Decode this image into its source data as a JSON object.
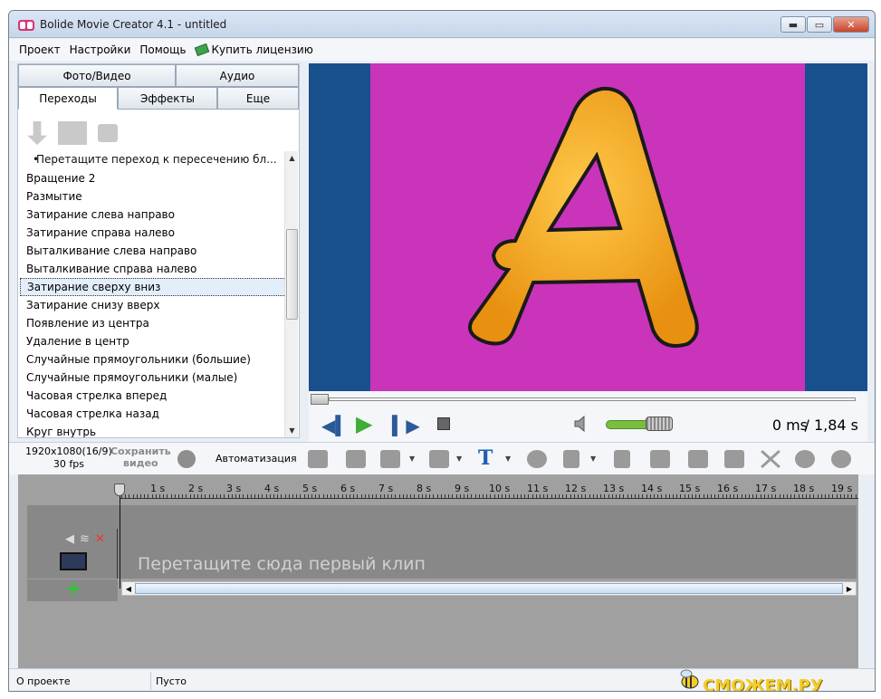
{
  "window": {
    "title": "Bolide Movie Creator 4.1 - untitled",
    "min": "▬",
    "max": "▭",
    "close": "✕"
  },
  "menu": {
    "items": [
      "Проект",
      "Настройки",
      "Помощь"
    ],
    "buy": "Купить лицензию"
  },
  "tabs": {
    "row1": [
      "Фото/Видео",
      "Аудио"
    ],
    "row2": [
      "Переходы",
      "Эффекты",
      "Еще"
    ]
  },
  "transitions": {
    "hint": "Перетащите переход к пересечению бл...",
    "items": [
      "Вращение 2",
      "Размытие",
      "Затирание слева направо",
      "Затирание справа налево",
      "Выталкивание слева направо",
      "Выталкивание справа налево",
      "Затирание сверху вниз",
      "Затирание снизу вверх",
      "Появление из центра",
      "Удаление в центр",
      "Случайные прямоугольники (большие)",
      "Случайные прямоугольники (малые)",
      "Часовая стрелка вперед",
      "Часовая стрелка назад",
      "Круг внутрь"
    ],
    "selected_index": 6
  },
  "playback": {
    "current": "0 ms",
    "total": "/ 1,84 s",
    "volume_fraction": 0.85
  },
  "toolbar": {
    "resolution": "1920x1080(16/9)",
    "fps": "30 fps",
    "save_video_line1": "Сохранить",
    "save_video_line2": "видео",
    "automation": "Автоматизация"
  },
  "timeline": {
    "ticks": [
      "1 s",
      "2 s",
      "3 s",
      "4 s",
      "5 s",
      "6 s",
      "7 s",
      "8 s",
      "9 s",
      "10 s",
      "11 s",
      "12 s",
      "13 s",
      "14 s",
      "15 s",
      "16 s",
      "17 s",
      "18 s",
      "19 s"
    ],
    "drop_hint": "Перетащите сюда первый клип",
    "add": "+"
  },
  "status": {
    "left": "О проекте",
    "right": "Пусто",
    "watermark": "СМОЖЕМ.РУ"
  },
  "colors": {
    "preview_bg": "#17508c",
    "canvas_bg": "#c934ba",
    "letter": "#f5a81c",
    "play": "#3eae36"
  }
}
